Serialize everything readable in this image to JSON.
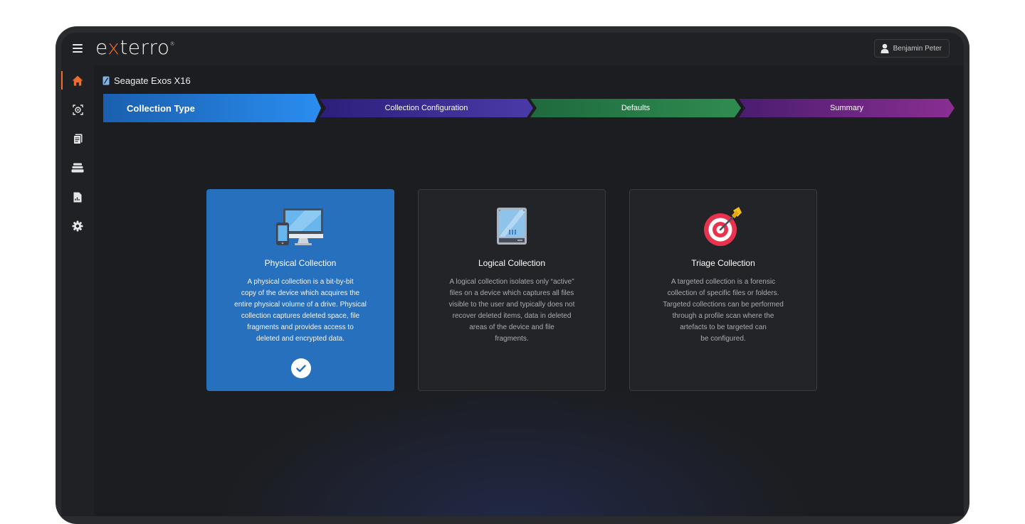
{
  "app": {
    "logo_pre": "e",
    "logo_x": "x",
    "logo_post": "terro",
    "logo_mark": "®"
  },
  "user": {
    "name": "Benjamin Peter",
    "icon": "user-icon"
  },
  "sidebar": {
    "items": [
      {
        "name": "home",
        "icon": "home-icon",
        "active": true
      },
      {
        "name": "collections",
        "icon": "target-scan-icon"
      },
      {
        "name": "documents",
        "icon": "document-icon"
      },
      {
        "name": "storage",
        "icon": "stack-icon"
      },
      {
        "name": "reports",
        "icon": "report-icon"
      },
      {
        "name": "settings",
        "icon": "gear-icon"
      }
    ]
  },
  "device": {
    "title": "Seagate Exos X16",
    "icon": "drive-icon"
  },
  "steps": [
    {
      "label": "Collection Type",
      "active": true,
      "color": "#2a8df0"
    },
    {
      "label": "Collection Configuration",
      "color": "#4a3aa8"
    },
    {
      "label": "Defaults",
      "color": "#2f8c50"
    },
    {
      "label": "Summary",
      "color": "#8a2e92"
    }
  ],
  "cards": [
    {
      "title": "Physical Collection",
      "icon": "computer-devices-icon",
      "selected": true,
      "lines": [
        "A physical collection is a bit-by-bit",
        "copy of the device which acquires the",
        "entire physical volume of a drive. Physical",
        "collection captures deleted space, file",
        "fragments and provides access to",
        "deleted and encrypted data."
      ]
    },
    {
      "title": "Logical Collection",
      "icon": "hard-drive-icon",
      "lines": [
        "A logical collection isolates only “active”",
        "files on a device which captures all files",
        "visible to  the user and typically does not",
        "recover deleted items, data in deleted",
        "areas of the device and file",
        "fragments."
      ]
    },
    {
      "title": "Triage Collection",
      "icon": "target-icon",
      "lines": [
        "A targeted collection is a forensic",
        "collection of specific files or folders.",
        "Targeted collections can be performed",
        "through a profile scan where the",
        "artefacts to be targeted can",
        "be configured."
      ]
    }
  ],
  "colors": {
    "accent": "#f26b2b",
    "selected_card": "#2770be"
  }
}
